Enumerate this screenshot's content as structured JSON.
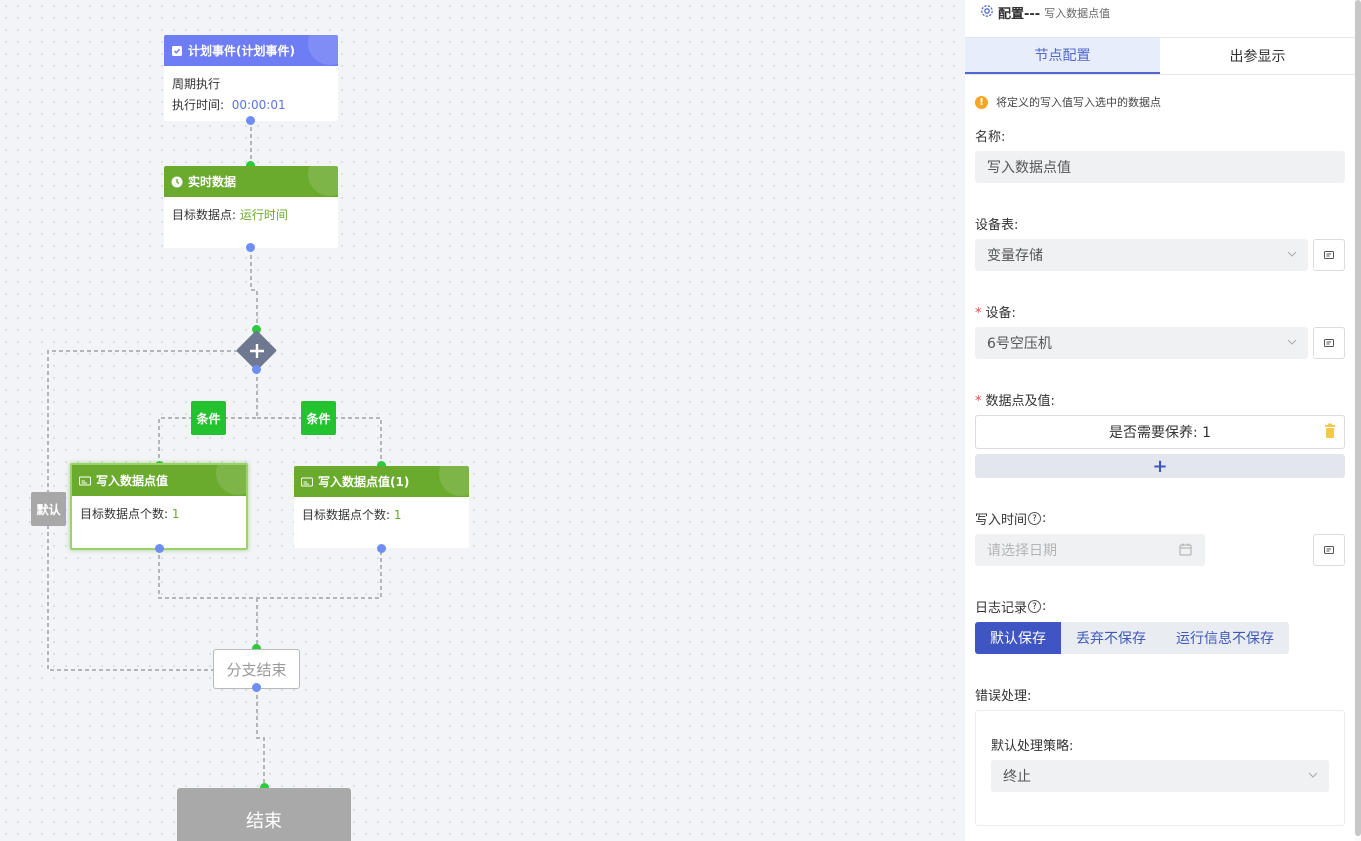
{
  "canvas": {
    "start_node": {
      "title": "计划事件(计划事件)",
      "line1": "周期执行",
      "line2_label": "执行时间:",
      "line2_value": "00:00:01"
    },
    "realtime_node": {
      "title": "实时数据",
      "label": "目标数据点:",
      "value": "运行时间"
    },
    "gateway_icon": "plus-icon",
    "condition_tags": [
      "条件",
      "条件"
    ],
    "default_tag": "默认",
    "write_node_1": {
      "title": "写入数据点值",
      "label": "目标数据点个数:",
      "value": "1"
    },
    "write_node_2": {
      "title": "写入数据点值(1)",
      "label": "目标数据点个数:",
      "value": "1"
    },
    "branch_end": "分支结束",
    "end_node": "结束"
  },
  "panel": {
    "title": "配置---",
    "subtitle": "写入数据点值",
    "tabs": [
      "节点配置",
      "出参显示"
    ],
    "notice": "将定义的写入值写入选中的数据点",
    "name_label": "名称:",
    "name_value": "写入数据点值",
    "device_table_label": "设备表:",
    "device_table_value": "变量存储",
    "device_label": "设备:",
    "device_value": "6号空压机",
    "datapoint_label": "数据点及值:",
    "datapoint_entry": "是否需要保养: 1",
    "add_symbol": "+",
    "write_time_label": "写入时间",
    "write_time_placeholder": "请选择日期",
    "log_label": "日志记录",
    "log_options": [
      "默认保存",
      "丢弃不保存",
      "运行信息不保存"
    ],
    "log_selected": "默认保存",
    "error_label": "错误处理:",
    "strategy_label": "默认处理策略:",
    "strategy_value": "终止",
    "colon": ":",
    "help": "?"
  },
  "colors": {
    "accent": "#3f55c2",
    "node_blue": "#6f7df5",
    "node_green": "#6aab2e",
    "tag_green": "#22c32f",
    "port_blue": "#6f8ef5",
    "port_green": "#2ccb3a"
  }
}
